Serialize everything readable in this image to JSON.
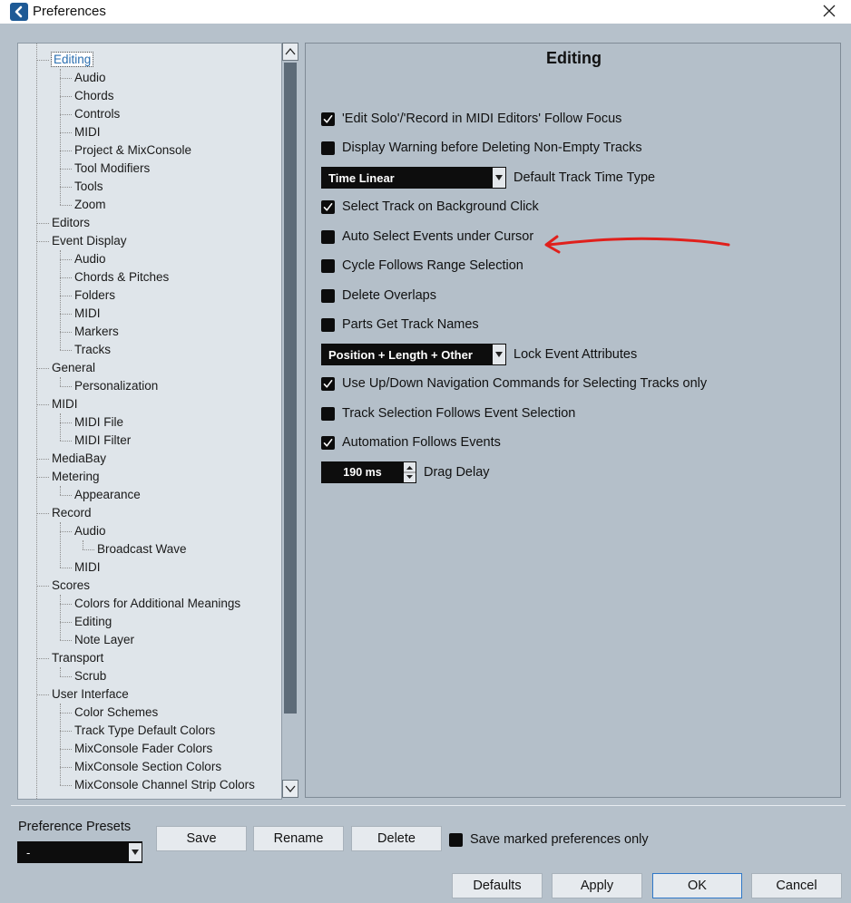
{
  "window": {
    "title": "Preferences",
    "app_icon": "cubase-icon",
    "close_icon": "close-icon"
  },
  "tree": {
    "items": [
      {
        "label": "Editing",
        "level": 1,
        "selected": true
      },
      {
        "label": "Audio",
        "level": 2
      },
      {
        "label": "Chords",
        "level": 2
      },
      {
        "label": "Controls",
        "level": 2
      },
      {
        "label": "MIDI",
        "level": 2
      },
      {
        "label": "Project & MixConsole",
        "level": 2
      },
      {
        "label": "Tool Modifiers",
        "level": 2
      },
      {
        "label": "Tools",
        "level": 2
      },
      {
        "label": "Zoom",
        "level": 2
      },
      {
        "label": "Editors",
        "level": 1
      },
      {
        "label": "Event Display",
        "level": 1
      },
      {
        "label": "Audio",
        "level": 2
      },
      {
        "label": "Chords & Pitches",
        "level": 2
      },
      {
        "label": "Folders",
        "level": 2
      },
      {
        "label": "MIDI",
        "level": 2
      },
      {
        "label": "Markers",
        "level": 2
      },
      {
        "label": "Tracks",
        "level": 2
      },
      {
        "label": "General",
        "level": 1
      },
      {
        "label": "Personalization",
        "level": 2
      },
      {
        "label": "MIDI",
        "level": 1
      },
      {
        "label": "MIDI File",
        "level": 2
      },
      {
        "label": "MIDI Filter",
        "level": 2
      },
      {
        "label": "MediaBay",
        "level": 1
      },
      {
        "label": "Metering",
        "level": 1
      },
      {
        "label": "Appearance",
        "level": 2
      },
      {
        "label": "Record",
        "level": 1
      },
      {
        "label": "Audio",
        "level": 2
      },
      {
        "label": "Broadcast Wave",
        "level": 3
      },
      {
        "label": "MIDI",
        "level": 2
      },
      {
        "label": "Scores",
        "level": 1
      },
      {
        "label": "Colors for Additional Meanings",
        "level": 2
      },
      {
        "label": "Editing",
        "level": 2
      },
      {
        "label": "Note Layer",
        "level": 2
      },
      {
        "label": "Transport",
        "level": 1
      },
      {
        "label": "Scrub",
        "level": 2
      },
      {
        "label": "User Interface",
        "level": 1
      },
      {
        "label": "Color Schemes",
        "level": 2
      },
      {
        "label": "Track Type Default Colors",
        "level": 2
      },
      {
        "label": "MixConsole Fader Colors",
        "level": 2
      },
      {
        "label": "MixConsole Section Colors",
        "level": 2
      },
      {
        "label": "MixConsole Channel Strip Colors",
        "level": 2
      }
    ]
  },
  "panel": {
    "title": "Editing",
    "options": [
      {
        "type": "checkbox",
        "label": "'Edit Solo'/'Record in MIDI Editors' Follow Focus",
        "checked": true
      },
      {
        "type": "checkbox",
        "label": "Display Warning before Deleting Non-Empty Tracks",
        "checked": false
      },
      {
        "type": "combo",
        "value": "Time Linear",
        "label": "Default Track Time Type"
      },
      {
        "type": "checkbox",
        "label": "Select Track on Background Click",
        "checked": true
      },
      {
        "type": "checkbox",
        "label": "Auto Select Events under Cursor",
        "checked": false
      },
      {
        "type": "checkbox",
        "label": "Cycle Follows Range Selection",
        "checked": false
      },
      {
        "type": "checkbox",
        "label": "Delete Overlaps",
        "checked": false
      },
      {
        "type": "checkbox",
        "label": "Parts Get Track Names",
        "checked": false
      },
      {
        "type": "combo",
        "value": "Position + Length + Other",
        "label": "Lock Event Attributes"
      },
      {
        "type": "checkbox",
        "label": "Use Up/Down Navigation Commands for Selecting Tracks only",
        "checked": true
      },
      {
        "type": "checkbox",
        "label": "Track Selection Follows Event Selection",
        "checked": false
      },
      {
        "type": "checkbox",
        "label": "Automation Follows Events",
        "checked": true
      },
      {
        "type": "spin",
        "value": "190 ms",
        "label": "Drag Delay"
      }
    ]
  },
  "bottom": {
    "presets_label": "Preference Presets",
    "presets_value": "-",
    "save_label": "Save",
    "rename_label": "Rename",
    "delete_label": "Delete",
    "save_marked_label": "Save marked preferences only",
    "save_marked_checked": false,
    "defaults_label": "Defaults",
    "apply_label": "Apply",
    "ok_label": "OK",
    "cancel_label": "Cancel"
  },
  "colors": {
    "background": "#b6c1cb",
    "tree_background": "#dfe5ea",
    "selection_text": "#2b6fb0",
    "annotation": "#e0201c",
    "primary_border": "#2f78c8"
  }
}
